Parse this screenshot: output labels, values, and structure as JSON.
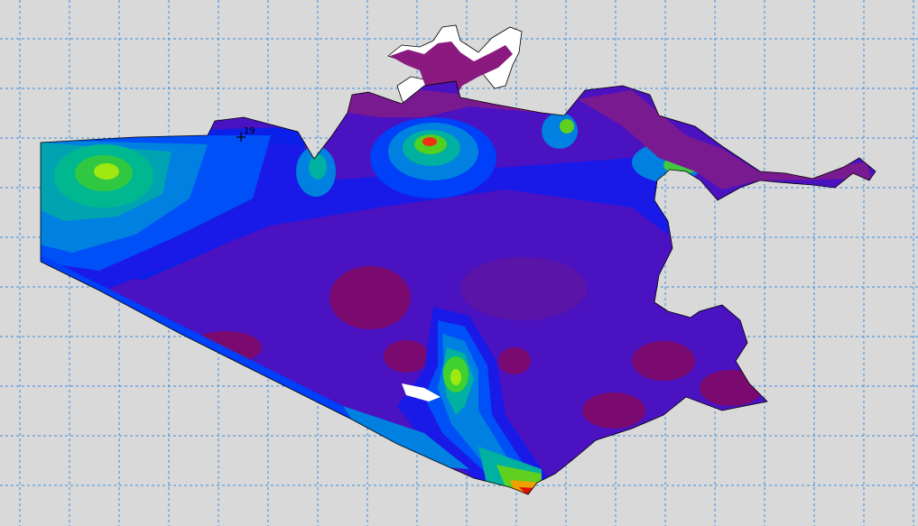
{
  "map": {
    "background_color": "#d9d9d9",
    "grid": {
      "visible": true,
      "style": "dashed",
      "color": "#3b8fe0"
    },
    "outline_color": "#000000",
    "color_scale": [
      "#8a0a78",
      "#5a10b0",
      "#1a10e0",
      "#0040f8",
      "#008cd0",
      "#00b09a",
      "#40d020",
      "#c0f000",
      "#f8a000",
      "#e01000"
    ],
    "marker": {
      "type": "cross",
      "label": "19"
    }
  }
}
